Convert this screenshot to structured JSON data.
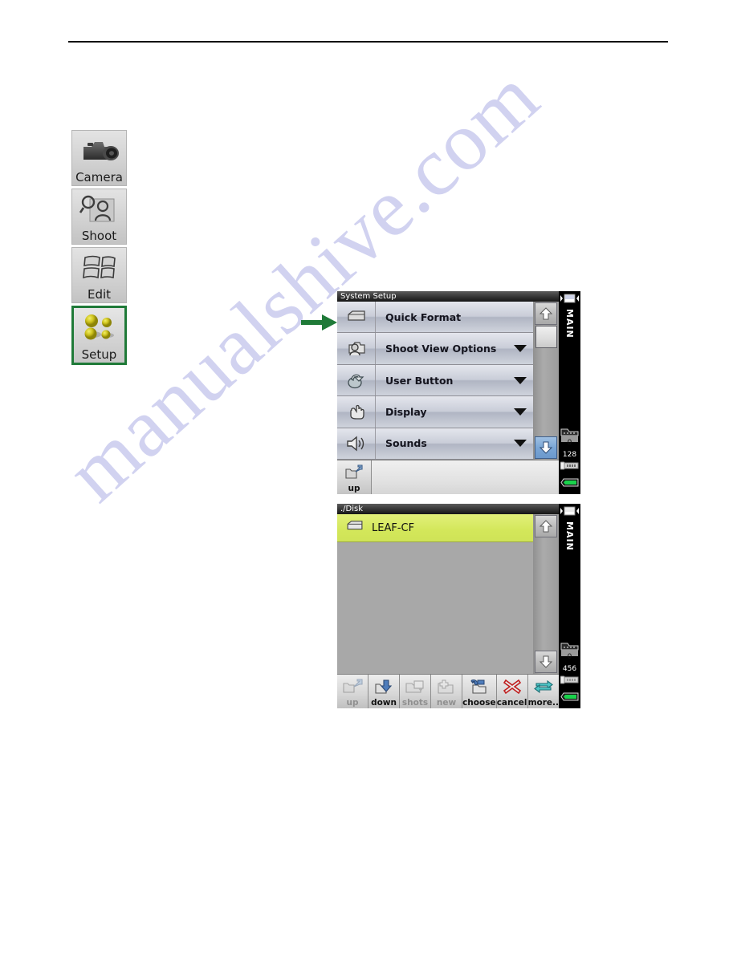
{
  "page": {
    "watermark": "manualshive.com"
  },
  "nav": {
    "items": [
      {
        "label": "Camera",
        "icon": "camera-icon",
        "selected": false
      },
      {
        "label": "Shoot",
        "icon": "shoot-icon",
        "selected": false
      },
      {
        "label": "Edit",
        "icon": "edit-icon",
        "selected": false
      },
      {
        "label": "Setup",
        "icon": "setup-icon",
        "selected": true
      }
    ],
    "selection_color": "#1f7a38"
  },
  "annotation": {
    "arrow": "right-arrow",
    "color": "#1f7a38",
    "points_to": "Quick Format"
  },
  "setup_panel": {
    "title": "System Setup",
    "rows": [
      {
        "label": "Quick Format",
        "icon": "disk-icon",
        "has_caret": false
      },
      {
        "label": "Shoot View Options",
        "icon": "camera-person-icon",
        "has_caret": true
      },
      {
        "label": "User Button",
        "icon": "arrow-button-icon",
        "has_caret": true
      },
      {
        "label": "Display",
        "icon": "hand-pointer-icon",
        "has_caret": true
      },
      {
        "label": "Sounds",
        "icon": "speaker-icon",
        "has_caret": true
      }
    ],
    "scrollbar": {
      "up_icon": "scroll-up-icon",
      "up_state": "inactive",
      "down_icon": "scroll-down-icon",
      "down_state": "active"
    },
    "bottom": {
      "up_label": "up",
      "up_icon": "up-folder-icon"
    },
    "status": {
      "card_label": "MAIN",
      "folder_count": "0",
      "shots_remaining": "128",
      "battery": "full",
      "battery_color": "#19d24b"
    }
  },
  "disk_panel": {
    "title": "./Disk",
    "rows": [
      {
        "label": "LEAF-CF",
        "icon": "disk-icon",
        "selected": true
      }
    ],
    "selection_color": "#d3e75a",
    "scrollbar": {
      "up_icon": "scroll-up-icon",
      "up_state": "inactive",
      "down_icon": "scroll-down-icon",
      "down_state": "inactive"
    },
    "toolbar": [
      {
        "label": "up",
        "icon": "up-folder-icon",
        "enabled": false
      },
      {
        "label": "down",
        "icon": "down-folder-icon",
        "enabled": true
      },
      {
        "label": "shots",
        "icon": "shots-folder-icon",
        "enabled": false
      },
      {
        "label": "new",
        "icon": "new-folder-icon",
        "enabled": false
      },
      {
        "label": "choose",
        "icon": "choose-folder-icon",
        "enabled": true
      },
      {
        "label": "cancel",
        "icon": "cancel-x-icon",
        "enabled": true
      },
      {
        "label": "more..",
        "icon": "more-cycle-icon",
        "enabled": true
      }
    ],
    "status": {
      "card_label": "MAIN",
      "folder_count": "0",
      "shots_remaining": "456",
      "battery": "full",
      "battery_color": "#19d24b"
    }
  }
}
